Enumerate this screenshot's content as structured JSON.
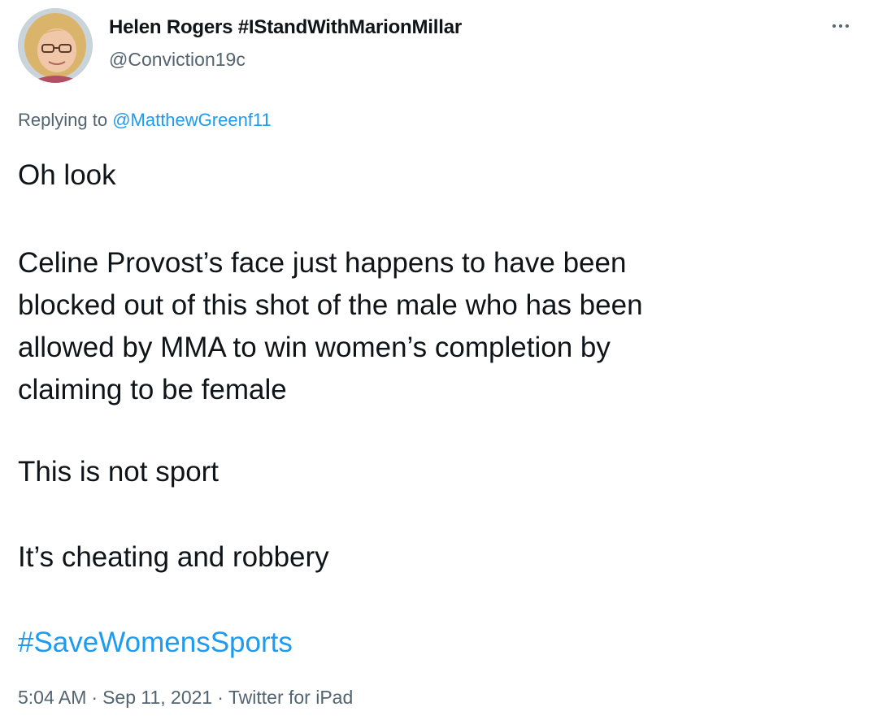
{
  "author": {
    "display_name": "Helen Rogers #IStandWithMarionMillar",
    "handle": "@Conviction19c",
    "avatar_icon": "profile-photo-avatar"
  },
  "menu": {
    "more_icon": "more-horizontal-icon"
  },
  "reply": {
    "prefix": "Replying to ",
    "mention": "@MatthewGreenf11"
  },
  "body": {
    "line1": "Oh look",
    "line2": "Celine Provost’s face just happens to have been",
    "line3": "blocked out of this shot of the male who has been",
    "line4": "allowed by MMA to win women’s completion by",
    "line5": "claiming to be female",
    "line6": "This is not sport",
    "line7": "It’s cheating and robbery",
    "hashtag": "#SaveWomensSports"
  },
  "meta": {
    "time": "5:04 AM",
    "date": "Sep 11, 2021",
    "source": "Twitter for iPad",
    "separator": "·"
  },
  "colors": {
    "text": "#0f1419",
    "muted": "#536471",
    "link": "#1d9bf0",
    "background": "#ffffff"
  }
}
